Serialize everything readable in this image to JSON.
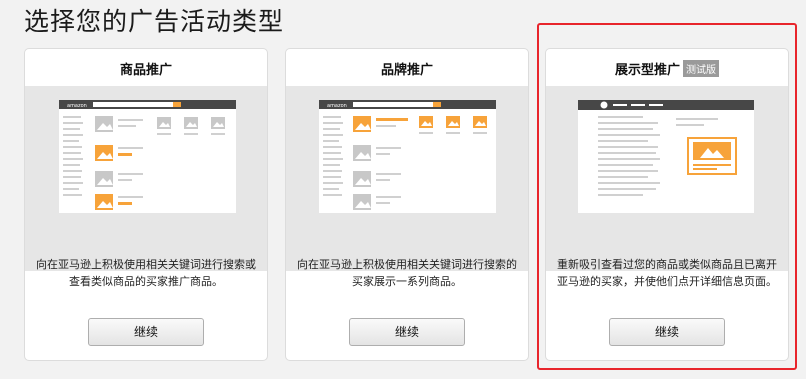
{
  "page": {
    "title": "选择您的广告活动类型"
  },
  "cards": [
    {
      "title": "商品推广",
      "badge": "",
      "description": "向在亚马逊上积极使用相关关键词进行搜索或查看类似商品的买家推广商品。",
      "button_label": "继续"
    },
    {
      "title": "品牌推广",
      "badge": "",
      "description": "向在亚马逊上积极使用相关关键词进行搜索的买家展示一系列商品。",
      "button_label": "继续"
    },
    {
      "title": "展示型推广",
      "badge": "测试版",
      "description": "重新吸引查看过您的商品或类似商品且已离开亚马逊的买家，并使他们点开详细信息页面。",
      "button_label": "继续"
    }
  ],
  "mockup": {
    "logo_text": "amazon"
  },
  "colors": {
    "accent": "#f7a33a",
    "highlight": "#e8252c",
    "dark_bar": "#474747"
  }
}
